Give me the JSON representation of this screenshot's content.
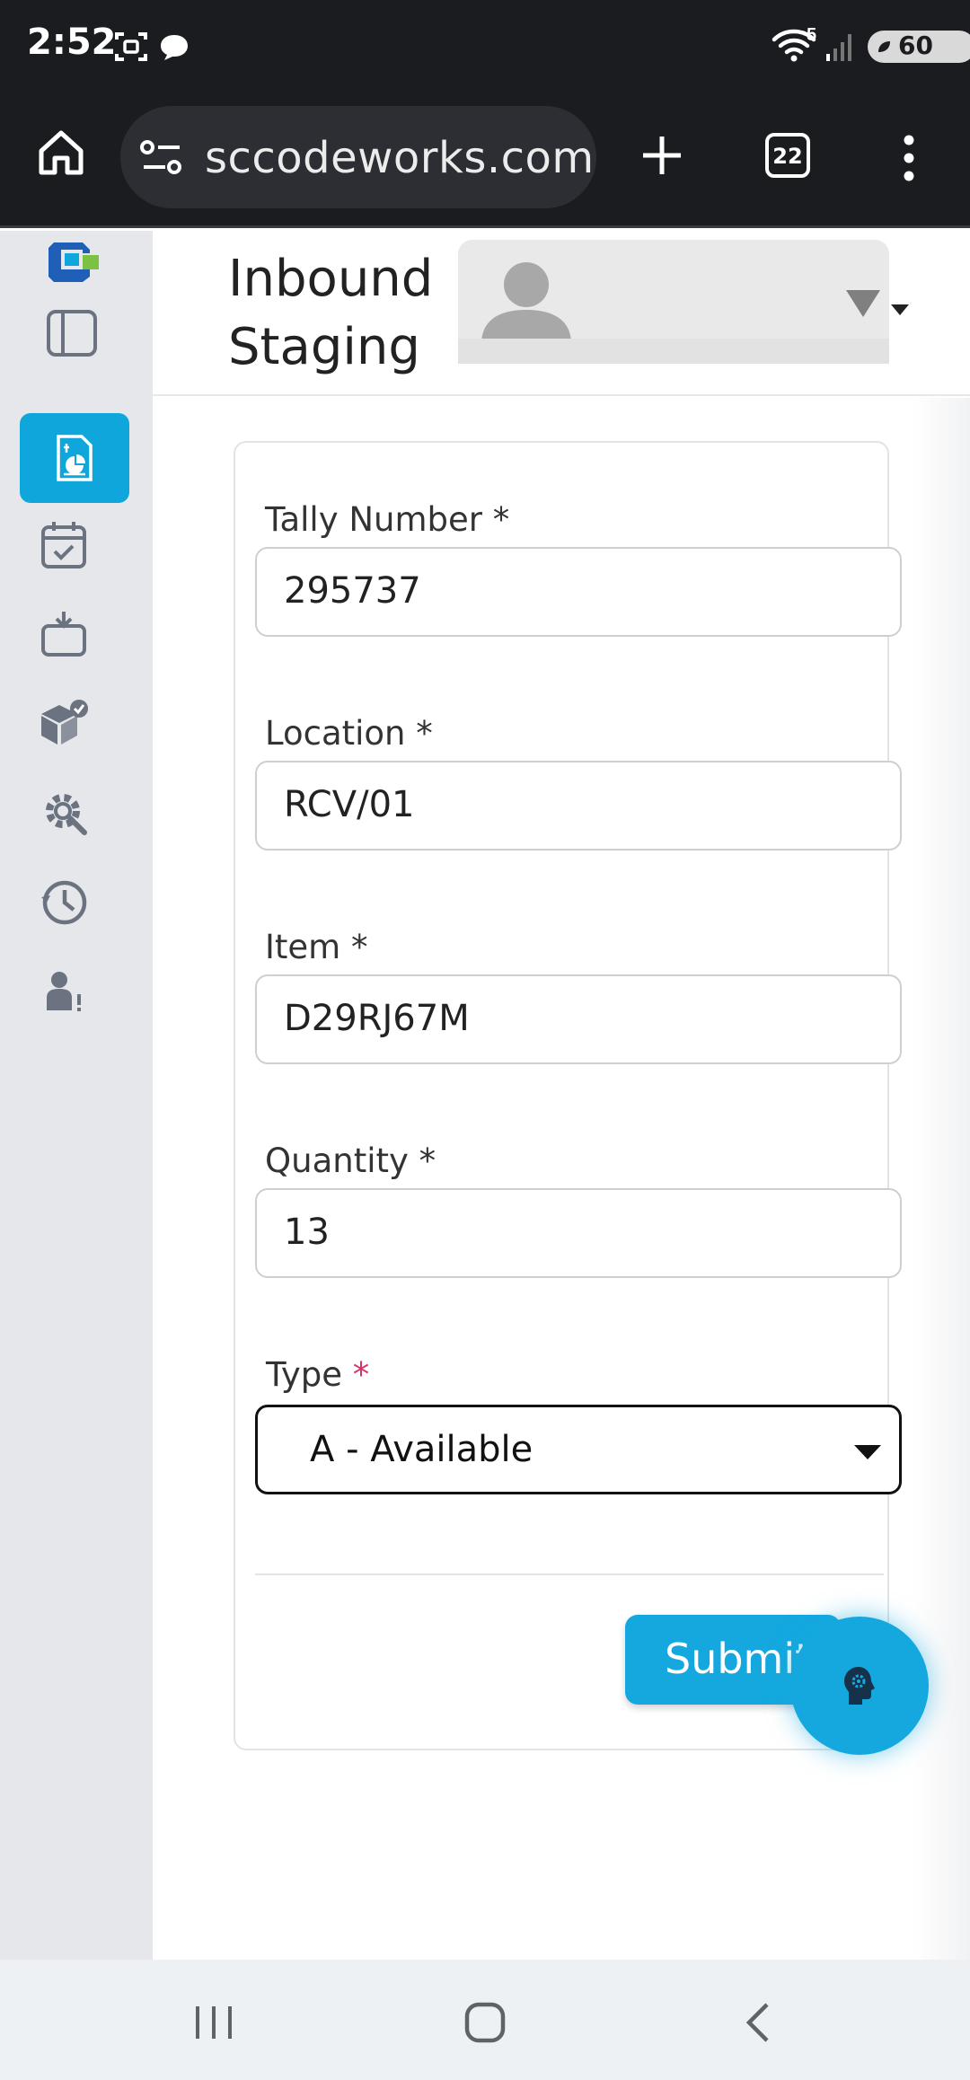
{
  "status_bar": {
    "time": "2:52",
    "wifi_badge": "5",
    "battery": "60"
  },
  "browser": {
    "url": "sccodeworks.com",
    "tab_count": "22"
  },
  "header": {
    "title": "Inbound Staging"
  },
  "form": {
    "fields": [
      {
        "label": "Tally Number",
        "required_mark": "*",
        "value": "295737"
      },
      {
        "label": "Location",
        "required_mark": "*",
        "value": "RCV/01"
      },
      {
        "label": "Item",
        "required_mark": "*",
        "value": "D29RJ67M"
      },
      {
        "label": "Quantity",
        "required_mark": "*",
        "value": "13"
      }
    ],
    "type_field": {
      "label": "Type",
      "required_mark": "*",
      "selected": "A - Available"
    },
    "submit_label": "Submit"
  },
  "colors": {
    "accent": "#14a8df",
    "required_pink": "#d6336c",
    "sidebar_bg": "#e6e7eb",
    "chrome_bg": "#1b1c1f"
  }
}
